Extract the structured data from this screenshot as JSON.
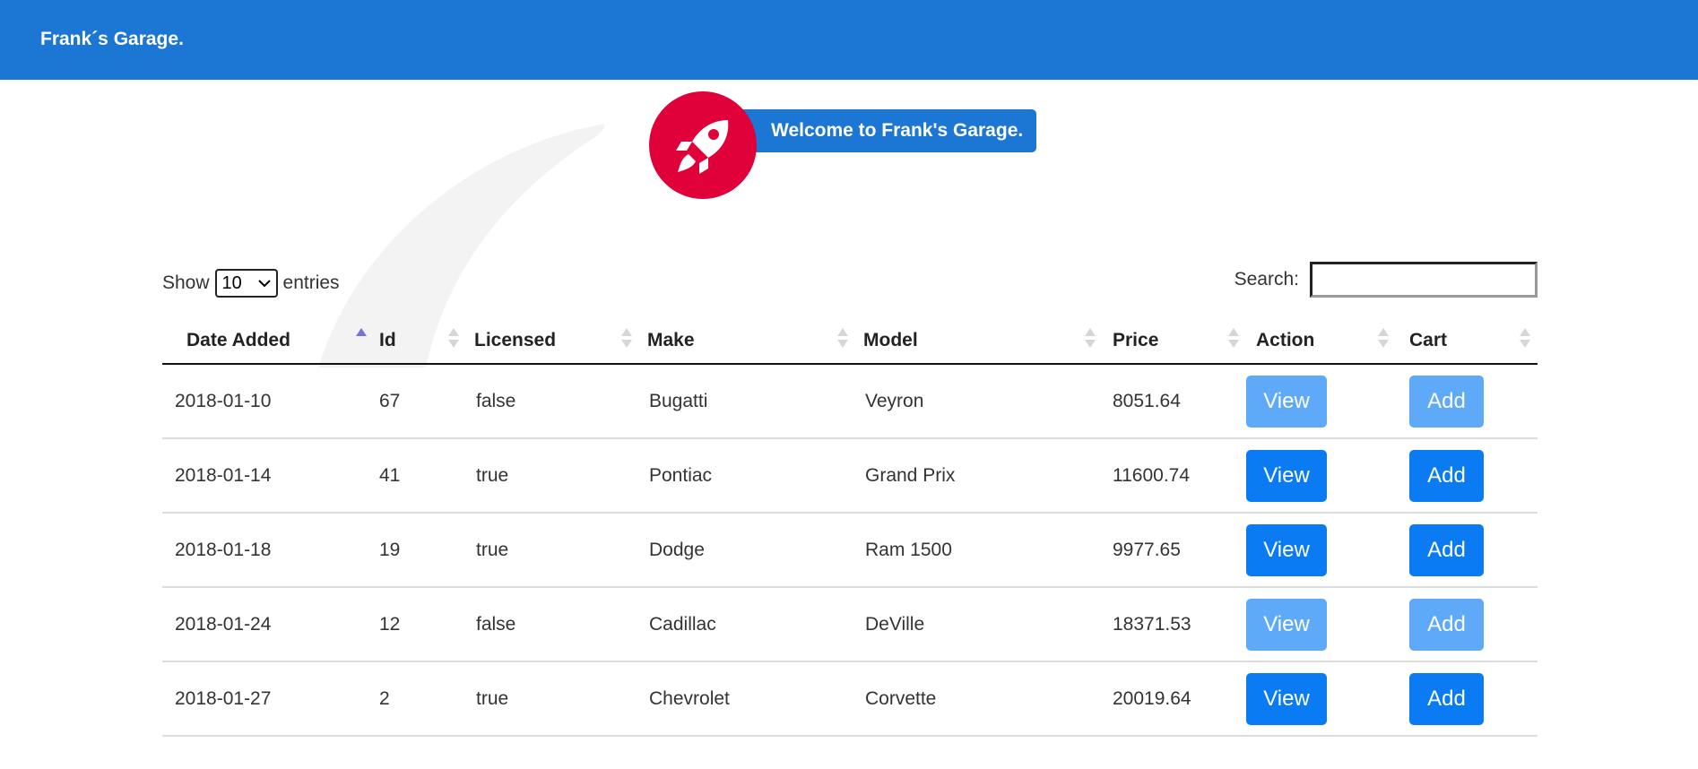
{
  "header": {
    "brand": "Frank´s Garage."
  },
  "hero": {
    "welcome": "Welcome to Frank's Garage."
  },
  "colors": {
    "header_bg": "#1c77d4",
    "rocket_badge": "#e0003a",
    "button_enabled": "#0a7bf2",
    "button_disabled": "#5eaaf9"
  },
  "icons": {
    "hero": "rocket-icon"
  },
  "controls": {
    "show_label": "Show",
    "show_value": "10",
    "entries_label": "entries",
    "search_label": "Search:",
    "search_value": ""
  },
  "table": {
    "columns": [
      "Date Added",
      "Id",
      "Licensed",
      "Make",
      "Model",
      "Price",
      "Action",
      "Cart"
    ],
    "sorted_column": "Date Added",
    "sort_direction": "ascending",
    "rows": [
      {
        "date": "2018-01-10",
        "id": "67",
        "licensed": "false",
        "make": "Bugatti",
        "model": "Veyron",
        "price": "8051.64",
        "action": "View",
        "cart": "Add",
        "enabled": false
      },
      {
        "date": "2018-01-14",
        "id": "41",
        "licensed": "true",
        "make": "Pontiac",
        "model": "Grand Prix",
        "price": "11600.74",
        "action": "View",
        "cart": "Add",
        "enabled": true
      },
      {
        "date": "2018-01-18",
        "id": "19",
        "licensed": "true",
        "make": "Dodge",
        "model": "Ram 1500",
        "price": "9977.65",
        "action": "View",
        "cart": "Add",
        "enabled": true
      },
      {
        "date": "2018-01-24",
        "id": "12",
        "licensed": "false",
        "make": "Cadillac",
        "model": "DeVille",
        "price": "18371.53",
        "action": "View",
        "cart": "Add",
        "enabled": false
      },
      {
        "date": "2018-01-27",
        "id": "2",
        "licensed": "true",
        "make": "Chevrolet",
        "model": "Corvette",
        "price": "20019.64",
        "action": "View",
        "cart": "Add",
        "enabled": true
      }
    ]
  }
}
